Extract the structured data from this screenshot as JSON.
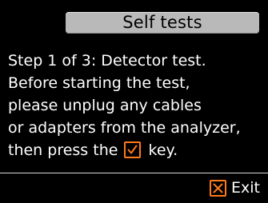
{
  "header": {
    "title": "Self tests"
  },
  "message": {
    "line1": "Step 1 of 3: Detector test.",
    "line2": "Before starting the test,",
    "line3": "please unplug any cables",
    "line4": "or adapters from the analyzer,",
    "line5_before": "then press the",
    "line5_icon": "checkmark-key-icon",
    "line5_after": "key."
  },
  "footer": {
    "exit_label": "Exit",
    "exit_icon": "close-x-icon"
  },
  "colors": {
    "background": "#000000",
    "title_bar": "#b9b9b9",
    "accent": "#ff7a1a",
    "text": "#ffffff"
  }
}
